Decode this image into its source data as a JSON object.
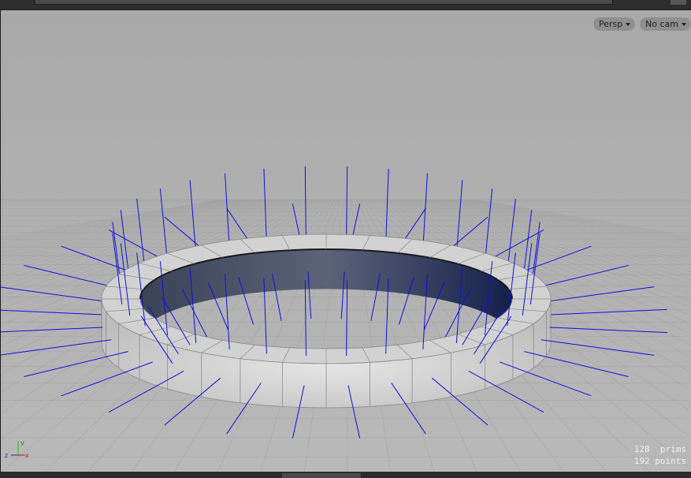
{
  "viewport": {
    "camera_menu": "Persp",
    "camera_select": "No cam",
    "stats": {
      "prims_count": "128",
      "prims_label": "prims",
      "points_count": "192",
      "points_label": "points"
    },
    "axis_labels": {
      "x": "x",
      "y": "y",
      "z": "z"
    }
  },
  "colors": {
    "normals": "#1010e0",
    "ring_face": "#cfcfcf",
    "ring_inner": "#2a3350",
    "grid": "#9a9a9a",
    "background": "#b0b0b0"
  },
  "icons": [
    "caret-down-icon",
    "axis-gizmo-icon"
  ]
}
